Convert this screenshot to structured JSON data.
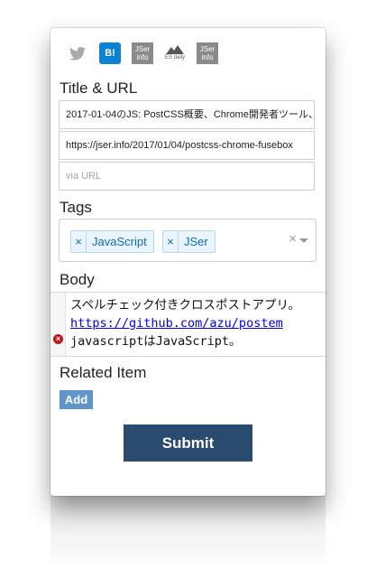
{
  "services": {
    "twitter": {
      "icon": "twitter-icon",
      "glyph": "🐦"
    },
    "hatena": {
      "icon": "hatena-bookmark-icon",
      "label": "B!"
    },
    "jser1": {
      "icon": "jser-info-icon",
      "line1": "JSer",
      "line2": "info"
    },
    "esdaily": {
      "icon": "es-daily-icon",
      "label": "ES daily"
    },
    "jser2": {
      "icon": "jser-info-icon",
      "line1": "JSer",
      "line2": "info"
    }
  },
  "title_section": {
    "heading": "Title & URL",
    "title_value": "2017-01-04のJS: PostCSS概要、Chrome開発者ツール、",
    "url_value": "https://jser.info/2017/01/04/postcss-chrome-fusebox",
    "via_placeholder": "via URL"
  },
  "tags_section": {
    "heading": "Tags",
    "remove_glyph": "×",
    "tags": [
      {
        "label": "JavaScript"
      },
      {
        "label": "JSer"
      }
    ],
    "clear_glyph": "×"
  },
  "body_section": {
    "heading": "Body",
    "lines": [
      "スペルチェック付きクロスポストアプリ。",
      "https://github.com/azu/postem",
      "javascriptはJavaScript。"
    ],
    "error_glyph": "×"
  },
  "related_section": {
    "heading": "Related Item",
    "add_label": "Add"
  },
  "submit_label": "Submit",
  "colors": {
    "accent": "#2b4a6f",
    "tag_bg": "#eaf4fc",
    "tag_text": "#0e6bb0",
    "error": "#c0171c",
    "add_button": "#5f95c9"
  }
}
